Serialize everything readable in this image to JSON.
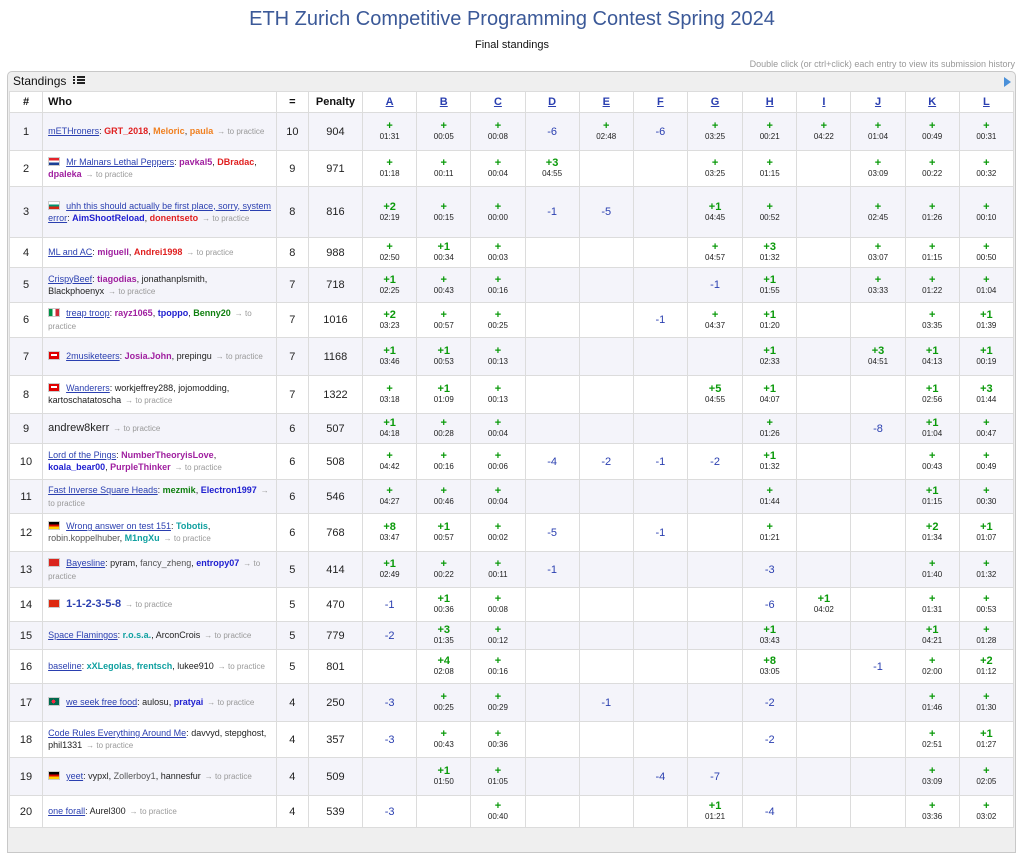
{
  "header": {
    "title": "ETH Zurich Competitive Programming Contest Spring 2024",
    "subtitle": "Final standings",
    "hint": "Double click (or ctrl+click) each entry to view its submission history"
  },
  "standings_label": "Standings",
  "columns": {
    "rank": "#",
    "who": "Who",
    "solved": "=",
    "penalty": "Penalty",
    "problems": [
      "A",
      "B",
      "C",
      "D",
      "E",
      "F",
      "G",
      "H",
      "I",
      "J",
      "K",
      "L"
    ]
  },
  "colors": {
    "title": "#3b5998",
    "accepted": "#0a9a0a",
    "rejected": "#2a3fb0",
    "link": "#2a3fb0"
  },
  "practice_label": "→ to practice",
  "rows": [
    {
      "rank": "1",
      "flag": "",
      "team": "mETHroners",
      "big": false,
      "members": [
        {
          "n": "GRT_2018",
          "c": "red"
        },
        {
          "n": "Meloric",
          "c": "orange"
        },
        {
          "n": "paula",
          "c": "orange"
        }
      ],
      "solved": "10",
      "penalty": "904",
      "cells": [
        {
          "r": "+",
          "t": "01:31"
        },
        {
          "r": "+",
          "t": "00:05"
        },
        {
          "r": "+",
          "t": "00:08"
        },
        {
          "r": "-6"
        },
        {
          "r": "+",
          "t": "02:48"
        },
        {
          "r": "-6"
        },
        {
          "r": "+",
          "t": "03:25"
        },
        {
          "r": "+",
          "t": "00:21"
        },
        {
          "r": "+",
          "t": "04:22"
        },
        {
          "r": "+",
          "t": "01:04"
        },
        {
          "r": "+",
          "t": "00:49"
        },
        {
          "r": "+",
          "t": "00:31"
        }
      ]
    },
    {
      "rank": "2",
      "flag": "hr",
      "team": "Mr Malnars Lethal Peppers",
      "big": false,
      "members": [
        {
          "n": "pavkal5",
          "c": "purple"
        },
        {
          "n": "DBradac",
          "c": "red"
        },
        {
          "n": "dpaleka",
          "c": "purple"
        }
      ],
      "solved": "9",
      "penalty": "971",
      "cells": [
        {
          "r": "+",
          "t": "01:18"
        },
        {
          "r": "+",
          "t": "00:11"
        },
        {
          "r": "+",
          "t": "00:04"
        },
        {
          "r": "+3",
          "t": "04:55"
        },
        {},
        {},
        {
          "r": "+",
          "t": "03:25"
        },
        {
          "r": "+",
          "t": "01:15"
        },
        {},
        {
          "r": "+",
          "t": "03:09"
        },
        {
          "r": "+",
          "t": "00:22"
        },
        {
          "r": "+",
          "t": "00:32"
        }
      ]
    },
    {
      "rank": "3",
      "flag": "bg",
      "team": "uhh this should actually be first place, sorry, system error",
      "big": false,
      "members": [
        {
          "n": "AimShootReload",
          "c": "blue"
        },
        {
          "n": "donentseto",
          "c": "red"
        }
      ],
      "solved": "8",
      "penalty": "816",
      "cells": [
        {
          "r": "+2",
          "t": "02:19"
        },
        {
          "r": "+",
          "t": "00:15"
        },
        {
          "r": "+",
          "t": "00:00"
        },
        {
          "r": "-1"
        },
        {
          "r": "-5"
        },
        {},
        {
          "r": "+1",
          "t": "04:45"
        },
        {
          "r": "+",
          "t": "00:52"
        },
        {},
        {
          "r": "+",
          "t": "02:45"
        },
        {
          "r": "+",
          "t": "01:26"
        },
        {
          "r": "+",
          "t": "00:10"
        }
      ]
    },
    {
      "rank": "4",
      "flag": "",
      "team": "ML and AC",
      "big": false,
      "members": [
        {
          "n": "miguell",
          "c": "purple"
        },
        {
          "n": "Andrei1998",
          "c": "red"
        }
      ],
      "solved": "8",
      "penalty": "988",
      "cells": [
        {
          "r": "+",
          "t": "02:50"
        },
        {
          "r": "+1",
          "t": "00:34"
        },
        {
          "r": "+",
          "t": "00:03"
        },
        {},
        {},
        {},
        {
          "r": "+",
          "t": "04:57"
        },
        {
          "r": "+3",
          "t": "01:32"
        },
        {},
        {
          "r": "+",
          "t": "03:07"
        },
        {
          "r": "+",
          "t": "01:15"
        },
        {
          "r": "+",
          "t": "00:50"
        }
      ]
    },
    {
      "rank": "5",
      "flag": "",
      "team": "CrispyBeef",
      "big": false,
      "members": [
        {
          "n": "tiagodias",
          "c": "purple"
        },
        {
          "n": "jonathanplsmith",
          "c": "plain"
        },
        {
          "n": "Blackphoenyx",
          "c": "plain"
        }
      ],
      "solved": "7",
      "penalty": "718",
      "cells": [
        {
          "r": "+1",
          "t": "02:25"
        },
        {
          "r": "+",
          "t": "00:43"
        },
        {
          "r": "+",
          "t": "00:16"
        },
        {},
        {},
        {},
        {
          "r": "-1"
        },
        {
          "r": "+1",
          "t": "01:55"
        },
        {},
        {
          "r": "+",
          "t": "03:33"
        },
        {
          "r": "+",
          "t": "01:22"
        },
        {
          "r": "+",
          "t": "01:04"
        }
      ]
    },
    {
      "rank": "6",
      "flag": "it",
      "team": "treap troop",
      "big": false,
      "members": [
        {
          "n": "rayz1065",
          "c": "purple"
        },
        {
          "n": "tpoppo",
          "c": "blue"
        },
        {
          "n": "Benny20",
          "c": "green"
        }
      ],
      "solved": "7",
      "penalty": "1016",
      "cells": [
        {
          "r": "+2",
          "t": "03:23"
        },
        {
          "r": "+",
          "t": "00:57"
        },
        {
          "r": "+",
          "t": "00:25"
        },
        {},
        {},
        {
          "r": "-1"
        },
        {
          "r": "+",
          "t": "04:37"
        },
        {
          "r": "+1",
          "t": "01:20"
        },
        {},
        {},
        {
          "r": "+",
          "t": "03:35"
        },
        {
          "r": "+1",
          "t": "01:39"
        }
      ]
    },
    {
      "rank": "7",
      "flag": "ch",
      "team": "2musiketeers",
      "big": false,
      "members": [
        {
          "n": "Josia.John",
          "c": "purple"
        },
        {
          "n": "prepingu",
          "c": "plain"
        }
      ],
      "solved": "7",
      "penalty": "1168",
      "cells": [
        {
          "r": "+1",
          "t": "03:46"
        },
        {
          "r": "+1",
          "t": "00:53"
        },
        {
          "r": "+",
          "t": "00:13"
        },
        {},
        {},
        {},
        {},
        {
          "r": "+1",
          "t": "02:33"
        },
        {},
        {
          "r": "+3",
          "t": "04:51"
        },
        {
          "r": "+1",
          "t": "04:13"
        },
        {
          "r": "+1",
          "t": "00:19"
        }
      ]
    },
    {
      "rank": "8",
      "flag": "ch",
      "team": "Wanderers",
      "big": false,
      "members": [
        {
          "n": "workjeffrey288",
          "c": "plain"
        },
        {
          "n": "jojomodding",
          "c": "plain"
        },
        {
          "n": "kartoschatatoscha",
          "c": "plain"
        }
      ],
      "solved": "7",
      "penalty": "1322",
      "cells": [
        {
          "r": "+",
          "t": "03:18"
        },
        {
          "r": "+1",
          "t": "01:09"
        },
        {
          "r": "+",
          "t": "00:13"
        },
        {},
        {},
        {},
        {
          "r": "+5",
          "t": "04:55"
        },
        {
          "r": "+1",
          "t": "04:07"
        },
        {},
        {},
        {
          "r": "+1",
          "t": "02:56"
        },
        {
          "r": "+3",
          "t": "01:44"
        }
      ]
    },
    {
      "rank": "9",
      "flag": "",
      "team": "andrew8kerr",
      "big": true,
      "members": [],
      "solved": "6",
      "penalty": "507",
      "cells": [
        {
          "r": "+1",
          "t": "04:18"
        },
        {
          "r": "+",
          "t": "00:28"
        },
        {
          "r": "+",
          "t": "00:04"
        },
        {},
        {},
        {},
        {},
        {
          "r": "+",
          "t": "01:26"
        },
        {},
        {
          "r": "-8"
        },
        {
          "r": "+1",
          "t": "01:04"
        },
        {
          "r": "+",
          "t": "00:47"
        }
      ]
    },
    {
      "rank": "10",
      "flag": "",
      "team": "Lord of the Pings",
      "big": false,
      "members": [
        {
          "n": "NumberTheoryisLove",
          "c": "purple"
        },
        {
          "n": "koala_bear00",
          "c": "blue"
        },
        {
          "n": "PurpleThinker",
          "c": "purple"
        }
      ],
      "solved": "6",
      "penalty": "508",
      "cells": [
        {
          "r": "+",
          "t": "04:42"
        },
        {
          "r": "+",
          "t": "00:16"
        },
        {
          "r": "+",
          "t": "00:06"
        },
        {
          "r": "-4"
        },
        {
          "r": "-2"
        },
        {
          "r": "-1"
        },
        {
          "r": "-2"
        },
        {
          "r": "+1",
          "t": "01:32"
        },
        {},
        {},
        {
          "r": "+",
          "t": "00:43"
        },
        {
          "r": "+",
          "t": "00:49"
        }
      ]
    },
    {
      "rank": "11",
      "flag": "",
      "team": "Fast Inverse Square Heads",
      "big": false,
      "members": [
        {
          "n": "mezmik",
          "c": "green"
        },
        {
          "n": "Electron1997",
          "c": "blue"
        }
      ],
      "solved": "6",
      "penalty": "546",
      "cells": [
        {
          "r": "+",
          "t": "04:27"
        },
        {
          "r": "+",
          "t": "00:46"
        },
        {
          "r": "+",
          "t": "00:04"
        },
        {},
        {},
        {},
        {},
        {
          "r": "+",
          "t": "01:44"
        },
        {},
        {},
        {
          "r": "+1",
          "t": "01:15"
        },
        {
          "r": "+",
          "t": "00:30"
        }
      ]
    },
    {
      "rank": "12",
      "flag": "de",
      "team": "Wrong answer on test 151",
      "big": false,
      "members": [
        {
          "n": "Tobotis",
          "c": "cyan"
        },
        {
          "n": "robin.koppelhuber",
          "c": "gray"
        },
        {
          "n": "M1ngXu",
          "c": "cyan"
        }
      ],
      "solved": "6",
      "penalty": "768",
      "cells": [
        {
          "r": "+8",
          "t": "03:47"
        },
        {
          "r": "+1",
          "t": "00:57"
        },
        {
          "r": "+",
          "t": "00:02"
        },
        {
          "r": "-5"
        },
        {},
        {
          "r": "-1"
        },
        {},
        {
          "r": "+",
          "t": "01:21"
        },
        {},
        {},
        {
          "r": "+2",
          "t": "01:34"
        },
        {
          "r": "+1",
          "t": "01:07"
        }
      ]
    },
    {
      "rank": "13",
      "flag": "vn",
      "team": "Bayesline",
      "big": false,
      "members": [
        {
          "n": "pyram",
          "c": "plain"
        },
        {
          "n": "fancy_zheng",
          "c": "gray"
        },
        {
          "n": "entropy07",
          "c": "blue"
        }
      ],
      "solved": "5",
      "penalty": "414",
      "cells": [
        {
          "r": "+1",
          "t": "02:49"
        },
        {
          "r": "+",
          "t": "00:22"
        },
        {
          "r": "+",
          "t": "00:11"
        },
        {
          "r": "-1"
        },
        {},
        {},
        {},
        {
          "r": "-3"
        },
        {},
        {},
        {
          "r": "+",
          "t": "01:40"
        },
        {
          "r": "+",
          "t": "01:32"
        }
      ]
    },
    {
      "rank": "14",
      "flag": "cn",
      "team": "1-1-2-3-5-8",
      "big": "cn",
      "members": [],
      "solved": "5",
      "penalty": "470",
      "cells": [
        {
          "r": "-1"
        },
        {
          "r": "+1",
          "t": "00:36"
        },
        {
          "r": "+",
          "t": "00:08"
        },
        {},
        {},
        {},
        {},
        {
          "r": "-6"
        },
        {
          "r": "+1",
          "t": "04:02"
        },
        {},
        {
          "r": "+",
          "t": "01:31"
        },
        {
          "r": "+",
          "t": "00:53"
        }
      ]
    },
    {
      "rank": "15",
      "flag": "",
      "team": "Space Flamingos",
      "big": false,
      "members": [
        {
          "n": "r.o.s.a.",
          "c": "cyan"
        },
        {
          "n": "ArconCrois",
          "c": "plain"
        }
      ],
      "solved": "5",
      "penalty": "779",
      "cells": [
        {
          "r": "-2"
        },
        {
          "r": "+3",
          "t": "01:35"
        },
        {
          "r": "+",
          "t": "00:12"
        },
        {},
        {},
        {},
        {},
        {
          "r": "+1",
          "t": "03:43"
        },
        {},
        {},
        {
          "r": "+1",
          "t": "04:21"
        },
        {
          "r": "+",
          "t": "01:28"
        }
      ]
    },
    {
      "rank": "16",
      "flag": "",
      "team": "baseline",
      "big": false,
      "members": [
        {
          "n": "xXLegolas",
          "c": "cyan"
        },
        {
          "n": "frentsch",
          "c": "cyan"
        },
        {
          "n": "lukee910",
          "c": "plain"
        }
      ],
      "solved": "5",
      "penalty": "801",
      "cells": [
        {},
        {
          "r": "+4",
          "t": "02:08"
        },
        {
          "r": "+",
          "t": "00:16"
        },
        {},
        {},
        {},
        {},
        {
          "r": "+8",
          "t": "03:05"
        },
        {},
        {
          "r": "-1"
        },
        {
          "r": "+",
          "t": "02:00"
        },
        {
          "r": "+2",
          "t": "01:12"
        }
      ]
    },
    {
      "rank": "17",
      "flag": "bd",
      "team": "we seek free food",
      "big": false,
      "members": [
        {
          "n": "aulosu",
          "c": "plain"
        },
        {
          "n": "pratyai",
          "c": "blue"
        }
      ],
      "solved": "4",
      "penalty": "250",
      "cells": [
        {
          "r": "-3"
        },
        {
          "r": "+",
          "t": "00:25"
        },
        {
          "r": "+",
          "t": "00:29"
        },
        {},
        {
          "r": "-1"
        },
        {},
        {},
        {
          "r": "-2"
        },
        {},
        {},
        {
          "r": "+",
          "t": "01:46"
        },
        {
          "r": "+",
          "t": "01:30"
        }
      ]
    },
    {
      "rank": "18",
      "flag": "",
      "team": "Code Rules Everything Around Me",
      "big": false,
      "members": [
        {
          "n": "davvyd",
          "c": "plain"
        },
        {
          "n": "stepghost",
          "c": "plain"
        },
        {
          "n": "phil1331",
          "c": "plain"
        }
      ],
      "solved": "4",
      "penalty": "357",
      "cells": [
        {
          "r": "-3"
        },
        {
          "r": "+",
          "t": "00:43"
        },
        {
          "r": "+",
          "t": "00:36"
        },
        {},
        {},
        {},
        {},
        {
          "r": "-2"
        },
        {},
        {},
        {
          "r": "+",
          "t": "02:51"
        },
        {
          "r": "+1",
          "t": "01:27"
        }
      ]
    },
    {
      "rank": "19",
      "flag": "de",
      "team": "yeet",
      "big": false,
      "members": [
        {
          "n": "vypxl",
          "c": "plain"
        },
        {
          "n": "Zollerboy1",
          "c": "gray"
        },
        {
          "n": "hannesfur",
          "c": "plain"
        }
      ],
      "solved": "4",
      "penalty": "509",
      "cells": [
        {},
        {
          "r": "+1",
          "t": "01:50"
        },
        {
          "r": "+",
          "t": "01:05"
        },
        {},
        {},
        {
          "r": "-4"
        },
        {
          "r": "-7"
        },
        {},
        {},
        {},
        {
          "r": "+",
          "t": "03:09"
        },
        {
          "r": "+",
          "t": "02:05"
        }
      ]
    },
    {
      "rank": "20",
      "flag": "",
      "team": "one forall",
      "big": false,
      "members": [
        {
          "n": "Aurel300",
          "c": "plain"
        }
      ],
      "solved": "4",
      "penalty": "539",
      "cells": [
        {
          "r": "-3"
        },
        {},
        {
          "r": "+",
          "t": "00:40"
        },
        {},
        {},
        {},
        {
          "r": "+1",
          "t": "01:21"
        },
        {
          "r": "-4"
        },
        {},
        {},
        {
          "r": "+",
          "t": "03:36"
        },
        {
          "r": "+",
          "t": "03:02"
        }
      ]
    }
  ]
}
